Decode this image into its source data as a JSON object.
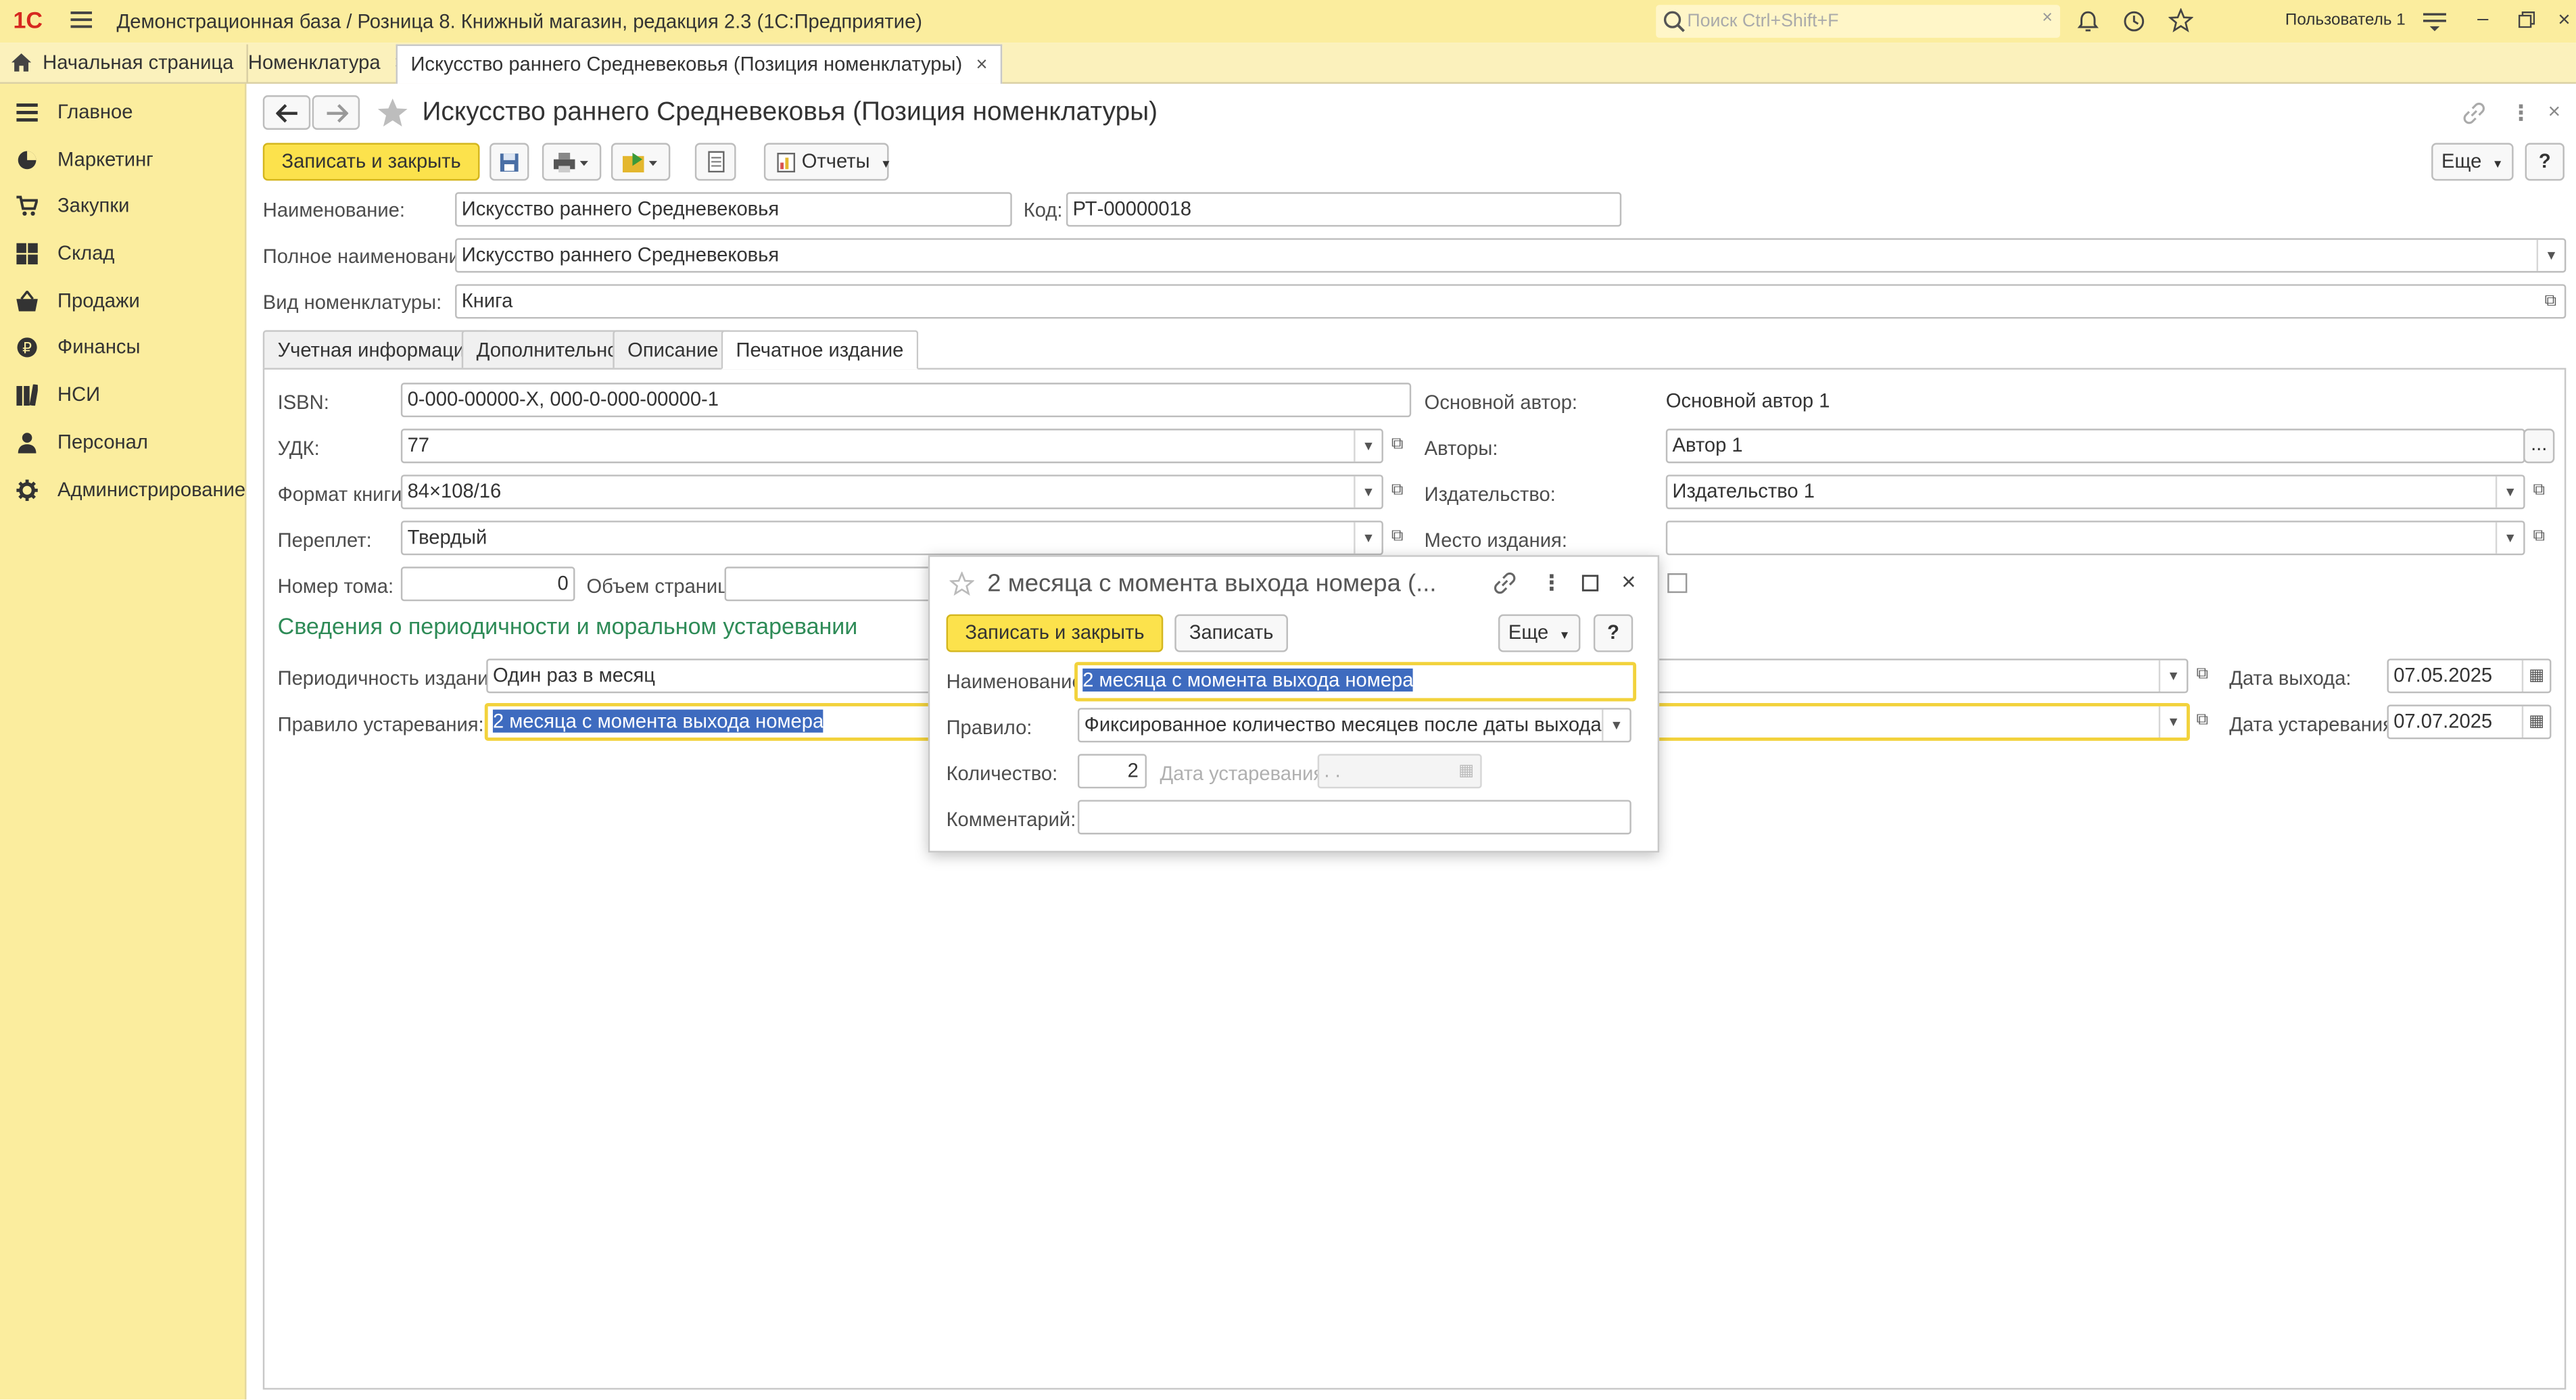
{
  "app": {
    "title": "Демонстрационная база / Розница 8. Книжный магазин, редакция 2.3  (1С:Предприятие)",
    "logo": "1С",
    "search_placeholder": "Поиск Ctrl+Shift+F",
    "user": "Пользователь 1",
    "icons": [
      "menu-icon",
      "search-icon",
      "bell-icon",
      "history-icon",
      "star-icon",
      "settings-icon",
      "minimize-icon",
      "restore-icon",
      "close-icon"
    ]
  },
  "tabs": {
    "home": "Начальная страница",
    "nomenclature": "Номенклатура",
    "item": "Искусство раннего Средневековья (Позиция номенклатуры)"
  },
  "sidebar": {
    "items": [
      {
        "label": "Главное",
        "icon": "list-icon"
      },
      {
        "label": "Маркетинг",
        "icon": "pie-chart-icon"
      },
      {
        "label": "Закупки",
        "icon": "cart-icon"
      },
      {
        "label": "Склад",
        "icon": "warehouse-icon"
      },
      {
        "label": "Продажи",
        "icon": "basket-icon"
      },
      {
        "label": "Финансы",
        "icon": "ruble-icon"
      },
      {
        "label": "НСИ",
        "icon": "books-icon"
      },
      {
        "label": "Персонал",
        "icon": "person-icon"
      },
      {
        "label": "Администрирование",
        "icon": "gear-icon"
      }
    ]
  },
  "form": {
    "title": "Искусство раннего Средневековья (Позиция номенклатуры)",
    "toolbar": {
      "save_close": "Записать и закрыть",
      "reports": "Отчеты",
      "more": "Еще",
      "help": "?"
    },
    "name_label": "Наименование:",
    "name_value": "Искусство раннего Средневековья",
    "code_label": "Код:",
    "code_value": "РТ-00000018",
    "fullname_label": "Полное наименование:",
    "fullname_value": "Искусство раннего Средневековья",
    "kind_label": "Вид номенклатуры:",
    "kind_value": "Книга",
    "page_tabs": [
      "Учетная информация",
      "Дополнительно",
      "Описание",
      "Печатное издание"
    ],
    "isbn_label": "ISBN:",
    "isbn_value": "0-000-00000-X, 000-0-000-00000-1",
    "udk_label": "УДК:",
    "udk_value": "77",
    "format_label": "Формат книги:",
    "format_value": "84×108/16",
    "binding_label": "Переплет:",
    "binding_value": "Твердый",
    "volume_label": "Номер тома:",
    "volume_value": "0",
    "pages_label": "Объем страниц:",
    "main_author_label": "Основной автор:",
    "main_author_value": "Основной автор 1",
    "authors_label": "Авторы:",
    "authors_value": "Автор 1",
    "publisher_label": "Издательство:",
    "publisher_value": "Издательство 1",
    "place_label": "Место издания:",
    "section_title": "Сведения о периодичности и моральном устаревании",
    "period_label": "Периодичность издания:",
    "period_value": "Один раз в месяц",
    "release_label": "Дата выхода:",
    "release_value": "07.05.2025",
    "rule_label": "Правило устаревания:",
    "rule_value": "2 месяца с момента выхода номера",
    "obsolete_label": "Дата устаревания:",
    "obsolete_value": "07.07.2025",
    "more_btn": "..."
  },
  "dialog": {
    "title": "2 месяца с момента выхода номера (...",
    "save_close": "Записать и закрыть",
    "save": "Записать",
    "more": "Еще",
    "help": "?",
    "name_label": "Наименование:",
    "name_value": "2 месяца с момента выхода номера",
    "rule_label": "Правило:",
    "rule_value": "Фиксированное количество месяцев после даты выхода",
    "qty_label": "Количество:",
    "qty_value": "2",
    "date_label": "Дата устаревания:",
    "date_placeholder": "  .  .",
    "comment_label": "Комментарий:"
  },
  "colors": {
    "topbar": "#fbed9e",
    "accent": "#fce24c",
    "section_title": "#2e8b57",
    "selection": "#3e6bbf"
  }
}
